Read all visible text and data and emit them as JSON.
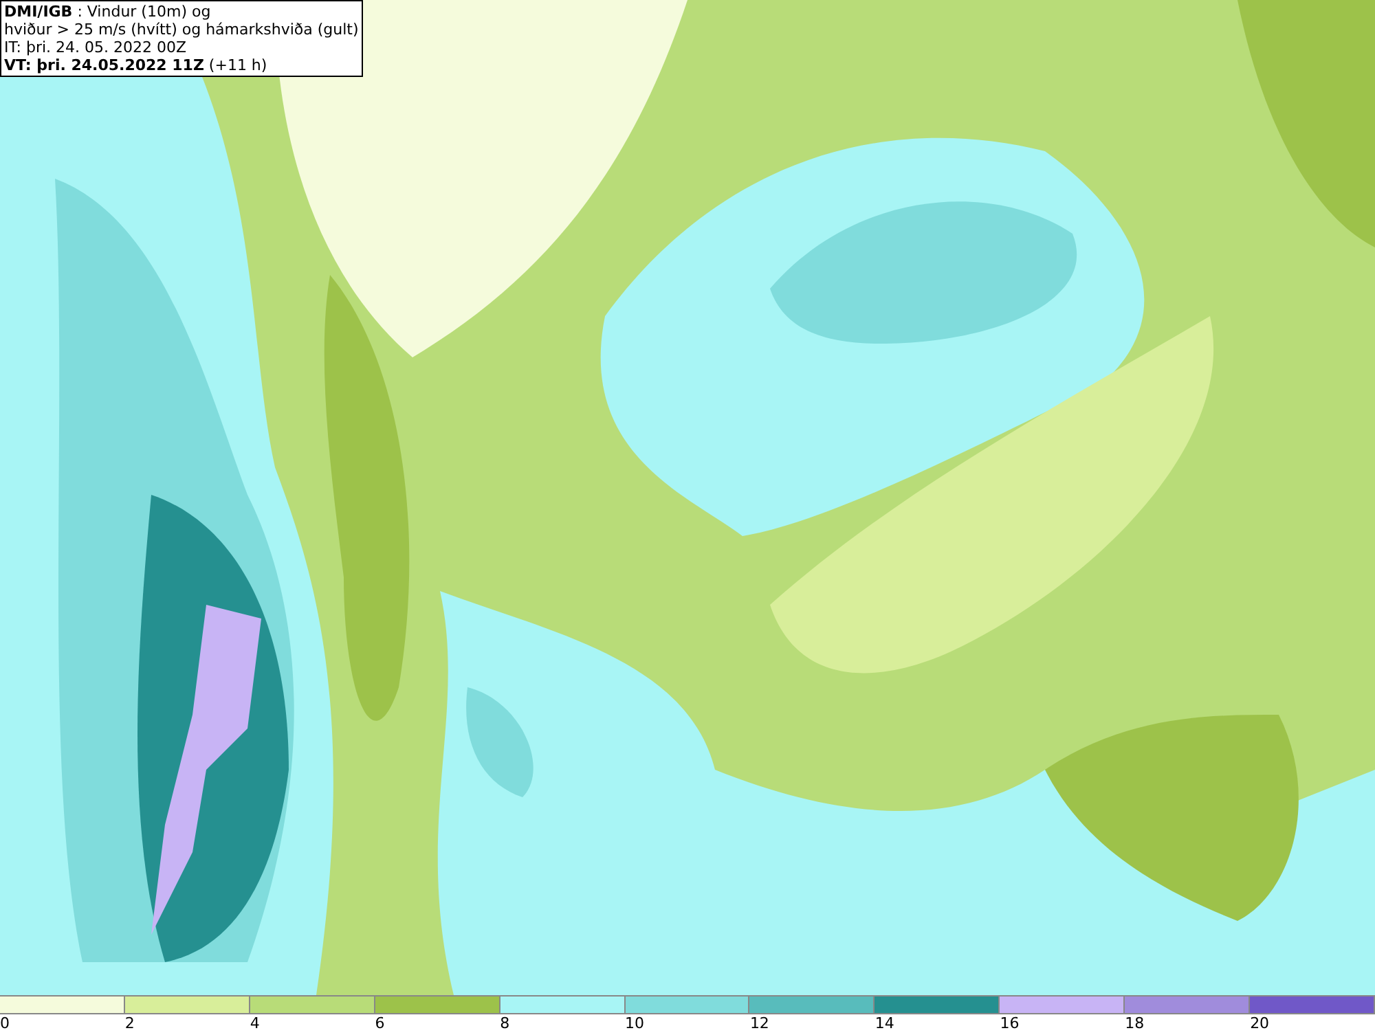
{
  "info": {
    "lines": [
      "**DMI/IGB** : Vindur (10m) og",
      "hviður > 25 m/s (hvítt) og hámarkshviða (gult)",
      "IT: þri. 24. 05. 2022 00Z",
      "**VT: þri. 24.05.2022 11Z** (+11 h)"
    ]
  },
  "legend": {
    "bins": [
      {
        "color": "#f5fbdc"
      },
      {
        "color": "#d8ee9a"
      },
      {
        "color": "#b8dc78"
      },
      {
        "color": "#9dc24a"
      },
      {
        "color": "#a8f5f5"
      },
      {
        "color": "#80dcdc"
      },
      {
        "color": "#58bcbc"
      },
      {
        "color": "#259090"
      },
      {
        "color": "#c8b4f5"
      },
      {
        "color": "#a08cdc"
      },
      {
        "color": "#7058c8"
      }
    ],
    "labels": [
      "0",
      "2",
      "4",
      "6",
      "8",
      "10",
      "12",
      "14",
      "16",
      "18",
      "20"
    ]
  }
}
